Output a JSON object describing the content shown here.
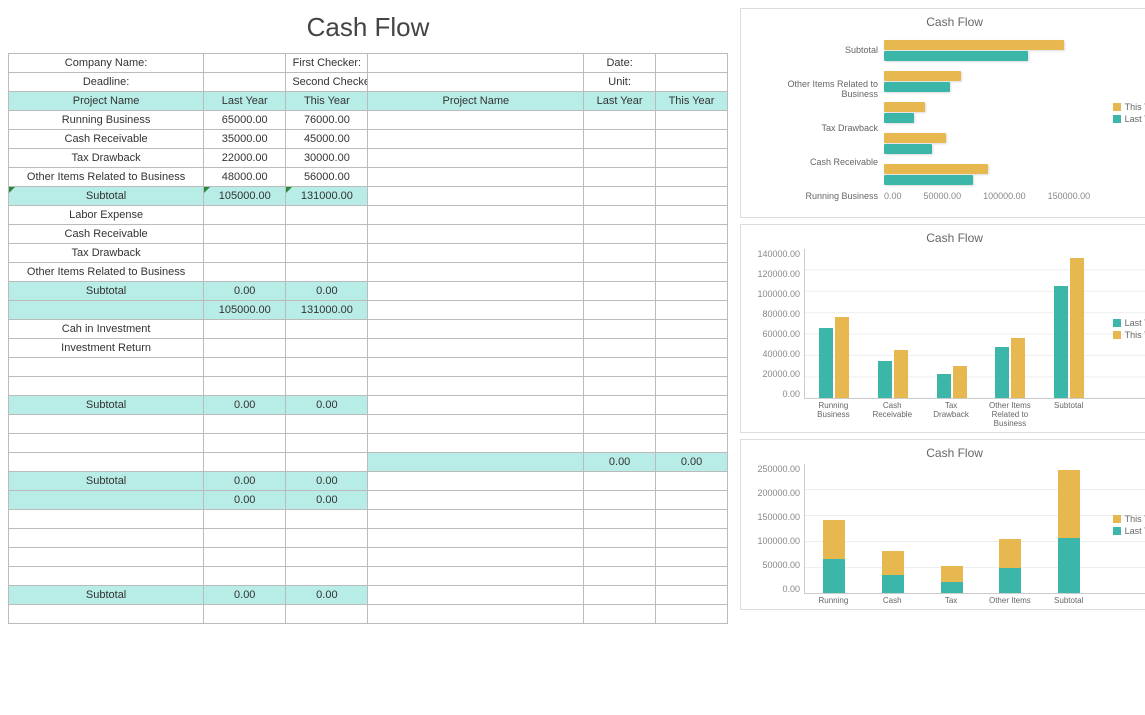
{
  "title": "Cash Flow",
  "header_row1": {
    "company_name": "Company Name:",
    "first_checker": "First Checker:",
    "date": "Date:"
  },
  "header_row2": {
    "deadline": "Deadline:",
    "second_checker": "Second Checker:",
    "unit": "Unit:"
  },
  "cols": {
    "proj": "Project Name",
    "last": "Last Year",
    "this": "This Year",
    "proj2": "Project Name",
    "last2": "Last Year",
    "this2": "This Year"
  },
  "rows": [
    {
      "name": "Running Business",
      "last": "65000.00",
      "this": "76000.00"
    },
    {
      "name": "Cash Receivable",
      "last": "35000.00",
      "this": "45000.00"
    },
    {
      "name": "Tax Drawback",
      "last": "22000.00",
      "this": "30000.00"
    },
    {
      "name": "Other Items Related to Business",
      "last": "48000.00",
      "this": "56000.00"
    },
    {
      "name": "Subtotal",
      "last": "105000.00",
      "this": "131000.00",
      "hl": true,
      "tri": true
    },
    {
      "name": "Labor Expense"
    },
    {
      "name": "Cash Receivable"
    },
    {
      "name": "Tax Drawback"
    },
    {
      "name": "Other Items Related to Business"
    },
    {
      "name": "Subtotal",
      "last": "0.00",
      "this": "0.00",
      "hl": true
    },
    {
      "name": "",
      "last": "105000.00",
      "this": "131000.00",
      "hl": true
    },
    {
      "name": "Cah in Investment"
    },
    {
      "name": "Investment Return"
    },
    {
      "name": ""
    },
    {
      "name": ""
    },
    {
      "name": "Subtotal",
      "last": "0.00",
      "this": "0.00",
      "hl": true
    },
    {
      "name": ""
    },
    {
      "name": ""
    },
    {
      "name": "",
      "hl_right": true,
      "r_last": "0.00",
      "r_this": "0.00"
    },
    {
      "name": "Subtotal",
      "last": "0.00",
      "this": "0.00",
      "hl": true
    },
    {
      "name": "",
      "last": "0.00",
      "this": "0.00",
      "hl": true
    },
    {
      "name": ""
    },
    {
      "name": ""
    },
    {
      "name": ""
    },
    {
      "name": ""
    },
    {
      "name": "Subtotal",
      "last": "0.00",
      "this": "0.00",
      "hl": true
    },
    {
      "name": ""
    }
  ],
  "chart_data": [
    {
      "type": "bar",
      "orientation": "horizontal",
      "title": "Cash Flow",
      "categories": [
        "Subtotal",
        "Other Items Related to Business",
        "Tax Drawback",
        "Cash Receivable",
        "Running Business"
      ],
      "series": [
        {
          "name": "This Year",
          "values": [
            131000,
            56000,
            30000,
            45000,
            76000
          ]
        },
        {
          "name": "Last Year",
          "values": [
            105000,
            48000,
            22000,
            35000,
            65000
          ]
        }
      ],
      "x_ticks": [
        "0.00",
        "50000.00",
        "100000.00",
        "150000.00"
      ],
      "xlim": [
        0,
        150000
      ]
    },
    {
      "type": "bar",
      "orientation": "vertical",
      "title": "Cash Flow",
      "categories": [
        "Running Business",
        "Cash Receivable",
        "Tax Drawback",
        "Other Items Related to Business",
        "Subtotal"
      ],
      "series": [
        {
          "name": "Last Year",
          "values": [
            65000,
            35000,
            22000,
            48000,
            105000
          ]
        },
        {
          "name": "This Year",
          "values": [
            76000,
            45000,
            30000,
            56000,
            131000
          ]
        }
      ],
      "y_ticks": [
        "0.00",
        "20000.00",
        "40000.00",
        "60000.00",
        "80000.00",
        "100000.00",
        "120000.00",
        "140000.00"
      ],
      "ylim": [
        0,
        140000
      ]
    },
    {
      "type": "bar",
      "stacked": true,
      "orientation": "vertical",
      "title": "Cash Flow",
      "categories": [
        "Running",
        "Cash",
        "Tax",
        "Other Items",
        "Subtotal"
      ],
      "series": [
        {
          "name": "Last Year",
          "values": [
            65000,
            35000,
            22000,
            48000,
            105000
          ]
        },
        {
          "name": "This Year",
          "values": [
            76000,
            45000,
            30000,
            56000,
            131000
          ]
        }
      ],
      "y_ticks": [
        "0.00",
        "50000.00",
        "100000.00",
        "150000.00",
        "200000.00",
        "250000.00"
      ],
      "ylim": [
        0,
        250000
      ]
    }
  ],
  "legend": {
    "this_year": "This Year",
    "last_year": "Last Year"
  }
}
